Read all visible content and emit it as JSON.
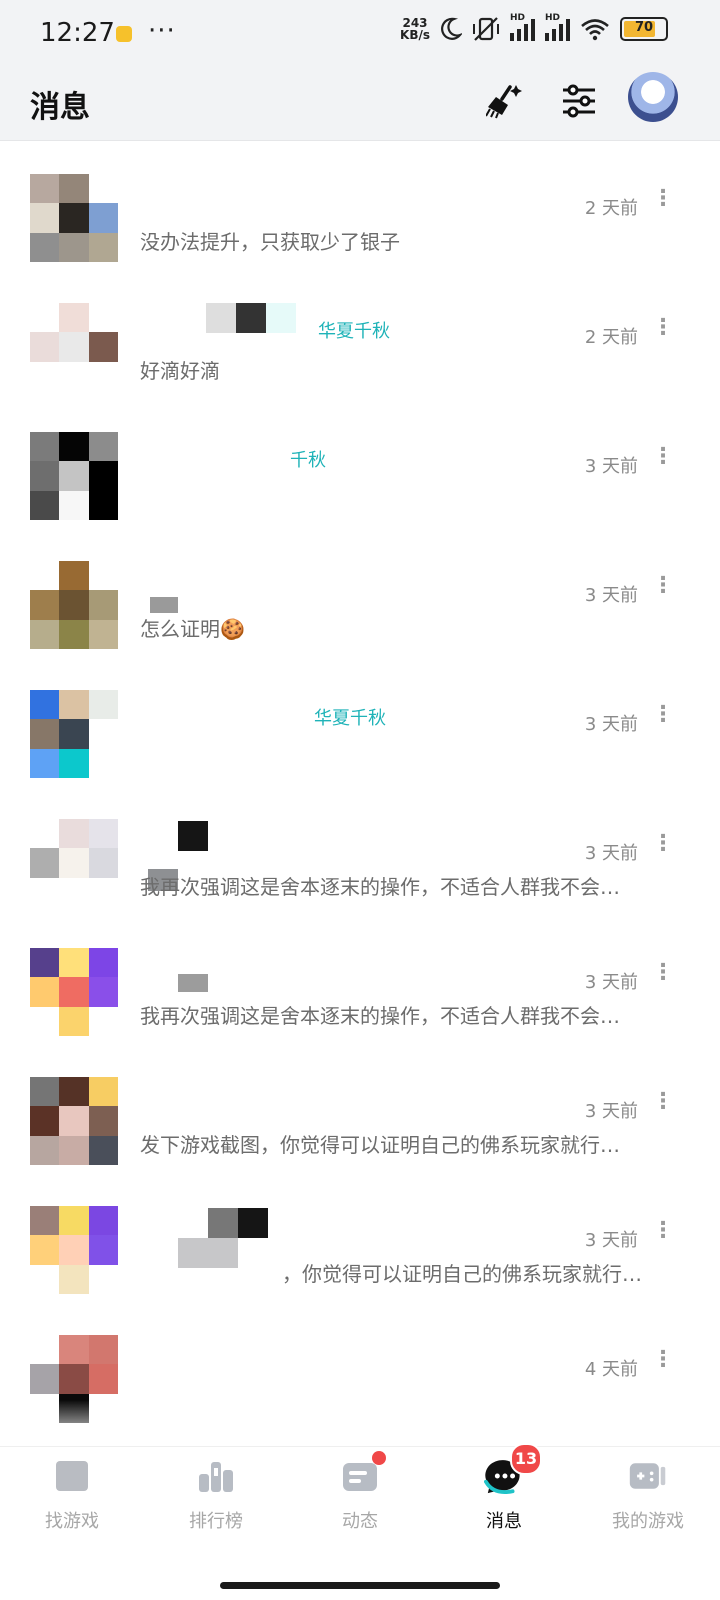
{
  "status_bar": {
    "time": "12:27",
    "dots": "···",
    "speed_value": "243",
    "speed_unit": "KB/s",
    "signal_label": "HD",
    "battery": "70"
  },
  "header": {
    "title": "消息",
    "icons": [
      "broom-icon",
      "sliders-icon",
      "profile-avatar"
    ]
  },
  "messages": [
    {
      "name": "",
      "time": "2 天前",
      "preview": "没办法提升，只获取少了银子"
    },
    {
      "name": "华夏千秋",
      "time": "2 天前",
      "preview": "好滴好滴"
    },
    {
      "name": "千秋",
      "time": "3 天前",
      "preview": ""
    },
    {
      "name": "",
      "time": "3 天前",
      "preview": "怎么证明🍪"
    },
    {
      "name": "华夏千秋",
      "time": "3 天前",
      "preview": ""
    },
    {
      "name": "",
      "time": "3 天前",
      "preview": "我再次强调这是舍本逐末的操作，不适合人群我不会…"
    },
    {
      "name": "",
      "time": "3 天前",
      "preview": "我再次强调这是舍本逐末的操作，不适合人群我不会…"
    },
    {
      "name": "",
      "time": "3 天前",
      "preview": "发下游戏截图，你觉得可以证明自己的佛系玩家就行…"
    },
    {
      "name": "",
      "time": "3 天前",
      "preview": "，你觉得可以证明自己的佛系玩家就行…"
    },
    {
      "name": "",
      "time": "4 天前",
      "preview": ""
    }
  ],
  "tabbar": {
    "tabs": [
      {
        "label": "找游戏",
        "icon": "find-game-icon"
      },
      {
        "label": "排行榜",
        "icon": "ranking-icon"
      },
      {
        "label": "动态",
        "icon": "feed-icon"
      },
      {
        "label": "消息",
        "icon": "message-icon"
      },
      {
        "label": "我的游戏",
        "icon": "my-games-icon"
      }
    ],
    "message_badge": "13",
    "active_tab": "消息"
  },
  "colors": {
    "accent": "#1fb3b8",
    "badge": "#f04848",
    "background": "#f2f3f5"
  }
}
